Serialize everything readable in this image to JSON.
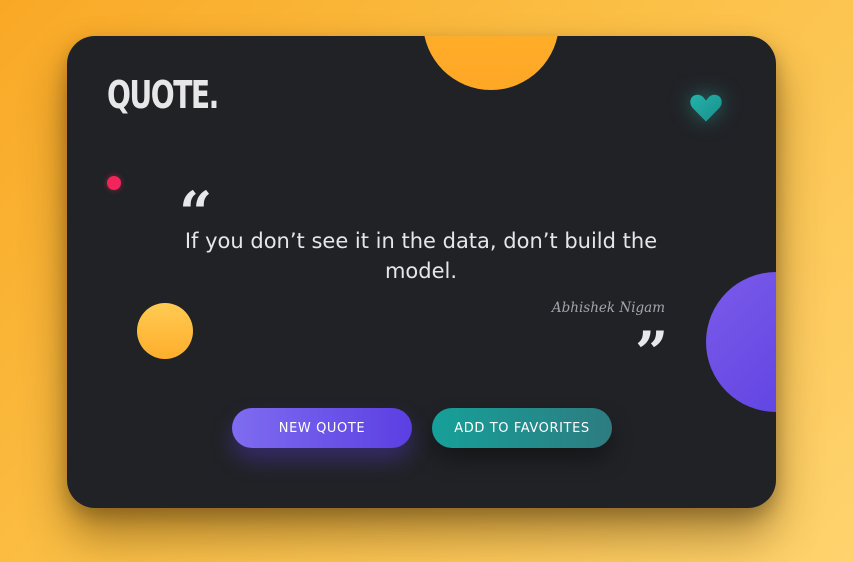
{
  "app": {
    "logo_text": "QUOTE."
  },
  "quote": {
    "open_mark": "“",
    "text": "If you don’t see it in the data, don’t build the model.",
    "author": "Abhishek Nigam",
    "close_mark": "”"
  },
  "actions": {
    "new_quote_label": "NEW QUOTE",
    "add_favorites_label": "ADD TO FAVORITES"
  },
  "icons": {
    "favorite": "heart-icon"
  },
  "colors": {
    "background_gradient_start": "#f9a825",
    "background_gradient_end": "#ffd36e",
    "card_background": "#212226",
    "heart": "#1fa39a",
    "accent_orange": "#ffa726",
    "accent_purple": "#5a3fe0",
    "accent_red": "#f2255a",
    "new_quote_button": "#6a52e8",
    "favorites_button": "#1a938e"
  }
}
